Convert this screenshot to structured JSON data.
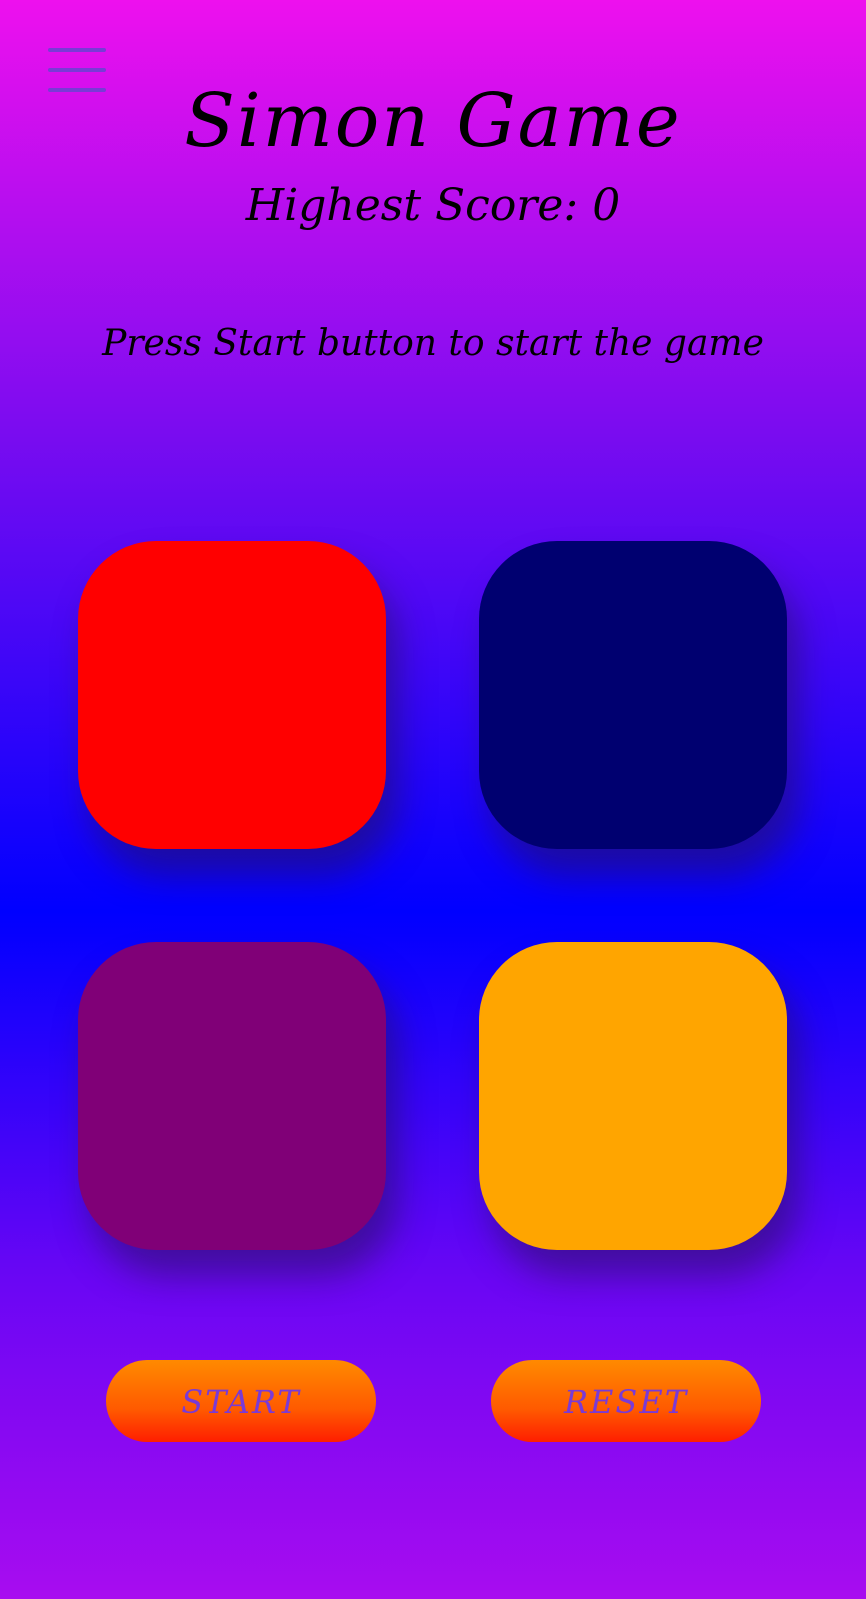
{
  "header": {
    "menu_icon": "hamburger-menu-icon",
    "title": "Simon Game",
    "highest_score_text": "Highest Score: 0",
    "message": "Press Start button to start the game"
  },
  "pads": [
    {
      "name": "red",
      "color": "#ff0000"
    },
    {
      "name": "navy",
      "color": "#000070"
    },
    {
      "name": "purple",
      "color": "#800077"
    },
    {
      "name": "orange",
      "color": "#ffa500"
    }
  ],
  "controls": {
    "start_label": "START",
    "reset_label": "RESET"
  }
}
